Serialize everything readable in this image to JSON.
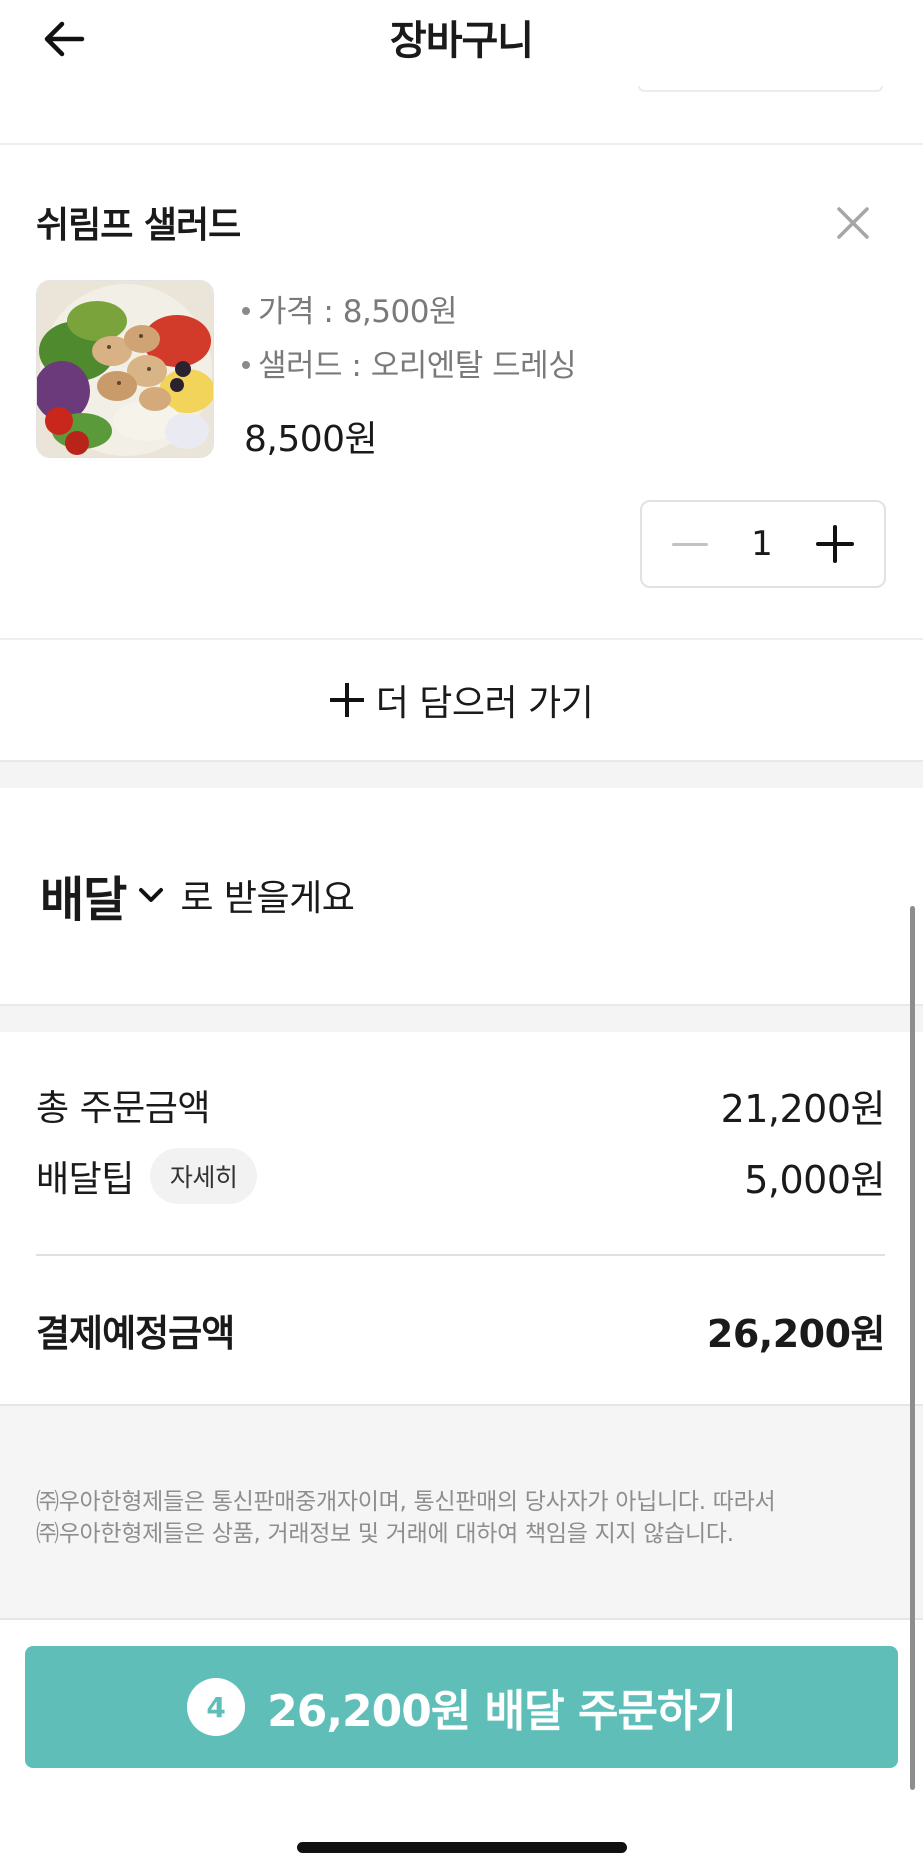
{
  "header": {
    "title": "장바구니",
    "back_icon": "arrow-left-icon"
  },
  "cart_item": {
    "name": "쉬림프 샐러드",
    "options": [
      "가격 : 8,500원",
      "샐러드 : 오리엔탈 드레싱"
    ],
    "price": "8,500원",
    "quantity": "1",
    "image_icon": "shrimp-salad-photo"
  },
  "add_more": {
    "label": "더 담으러 가기"
  },
  "delivery": {
    "mode": "배달",
    "suffix": "로 받을게요"
  },
  "summary": {
    "total_label": "총 주문금액",
    "total_value": "21,200원",
    "tip_label": "배달팁",
    "tip_detail_chip": "자세히",
    "tip_value": "5,000원",
    "payment_label": "결제예정금액",
    "payment_value": "26,200원"
  },
  "notice": {
    "line1": "㈜우아한형제들은 통신판매중개자이며, 통신판매의 당사자가 아닙니다. 따라서",
    "line2": "㈜우아한형제들은 상품, 거래정보 및 거래에 대하여 책임을 지지 않습니다."
  },
  "order_button": {
    "count": "4",
    "label": "26,200원 배달 주문하기"
  },
  "colors": {
    "accent": "#5fbfb8",
    "muted_text": "#7a7a7a",
    "band": "#f4f4f4"
  }
}
